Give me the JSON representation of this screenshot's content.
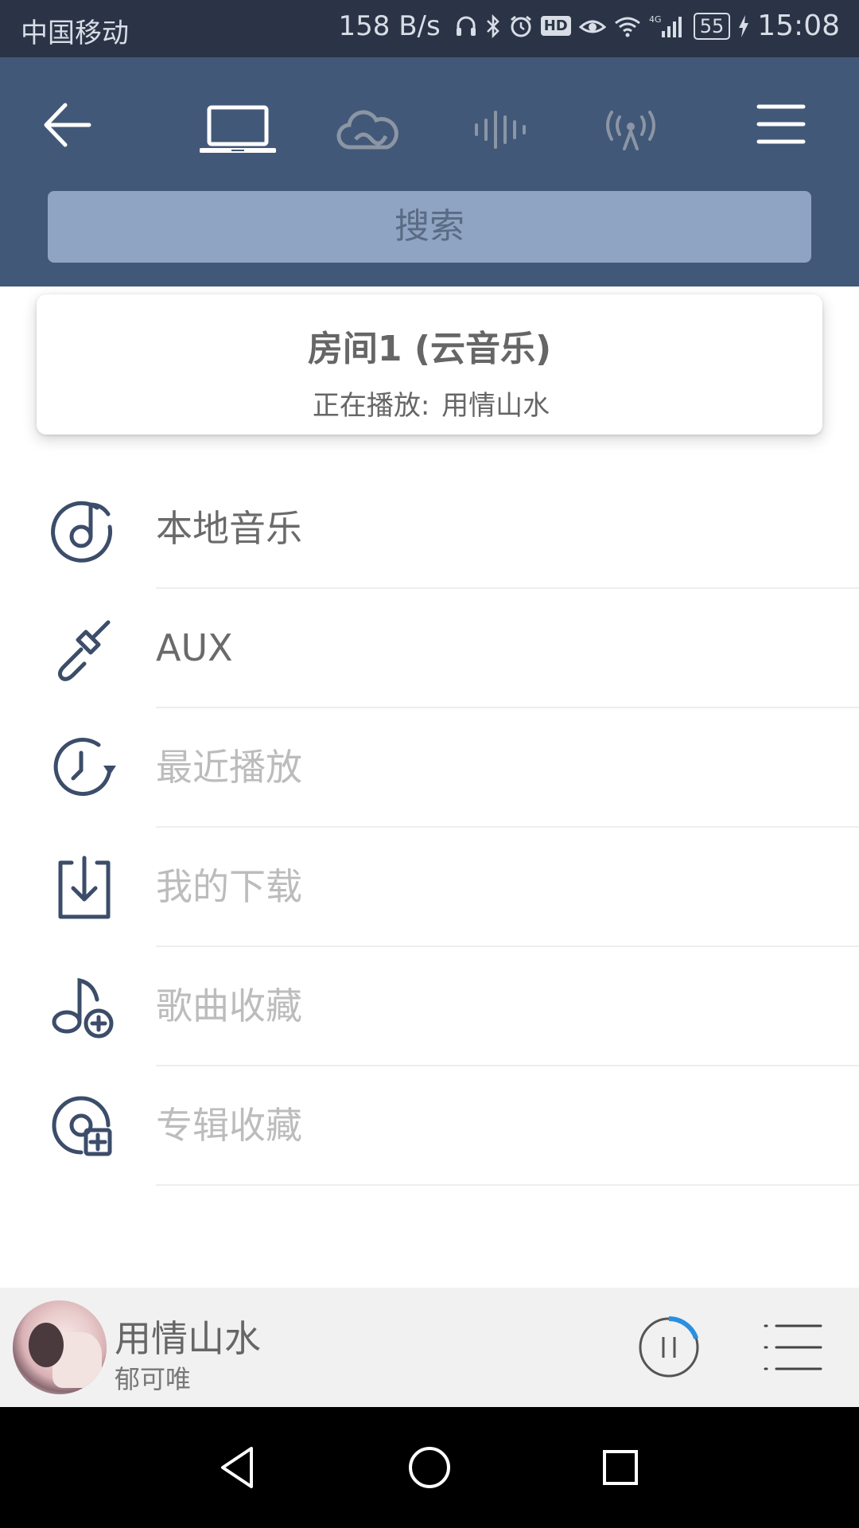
{
  "status_bar": {
    "carrier": "中国移动",
    "net_speed": "158 B/s",
    "icons": [
      "headphones-icon",
      "bluetooth-icon",
      "alarm-icon",
      "hd-icon",
      "eye-comfort-icon",
      "wifi-icon",
      "signal-4g-icon",
      "battery-icon",
      "charging-icon"
    ],
    "hd_label": "HD",
    "network_type": "4G",
    "battery_level": "55",
    "time": "15:08"
  },
  "header": {
    "tabs": [
      {
        "name": "local-device",
        "icon": "laptop-icon",
        "active": true
      },
      {
        "name": "cloud",
        "icon": "cloud-icon",
        "active": false
      },
      {
        "name": "sound",
        "icon": "sound-wave-icon",
        "active": false
      },
      {
        "name": "radio",
        "icon": "radio-antenna-icon",
        "active": false
      }
    ],
    "search_placeholder": "搜索"
  },
  "room": {
    "title": "房间1 (云音乐)",
    "playing_label": "正在播放:",
    "playing_song": "用情山水"
  },
  "menu": {
    "items": [
      {
        "label": "本地音乐",
        "icon": "music-note-circle-icon",
        "enabled": true
      },
      {
        "label": "AUX",
        "icon": "aux-cable-icon",
        "enabled": true
      },
      {
        "label": "最近播放",
        "icon": "recent-clock-icon",
        "enabled": false
      },
      {
        "label": "我的下载",
        "icon": "download-icon",
        "enabled": false
      },
      {
        "label": "歌曲收藏",
        "icon": "song-favorite-icon",
        "enabled": false
      },
      {
        "label": "专辑收藏",
        "icon": "album-favorite-icon",
        "enabled": false
      }
    ]
  },
  "player": {
    "song": "用情山水",
    "artist": "郁可唯",
    "playback_progress": 0.2
  },
  "colors": {
    "header_bg": "#425878",
    "status_bg": "#2a3446",
    "search_bg": "#8fa4c3",
    "icon_color": "#3c4d6a",
    "accent_blue": "#2b8fe0"
  }
}
